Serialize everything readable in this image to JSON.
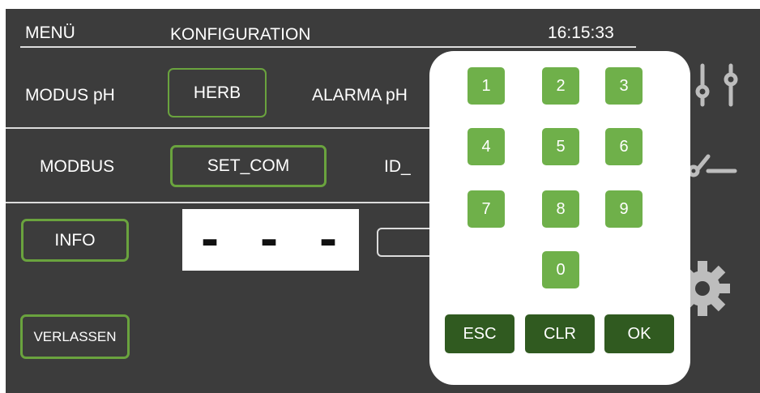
{
  "header": {
    "menu_label": "MENÜ",
    "title": "KONFIGURATION",
    "time": "16:15:33"
  },
  "rows": {
    "modus_ph_label": "MODUS pH",
    "modus_ph_value": "HERB",
    "alarma_ph_label": "ALARMA pH",
    "modbus_label": "MODBUS",
    "set_com_label": "SET_COM",
    "id_label": "ID_",
    "info_label": "INFO",
    "display_value": "- - -",
    "exit_label": "VERLASSEN"
  },
  "keypad": {
    "digits": [
      "1",
      "2",
      "3",
      "4",
      "5",
      "6",
      "7",
      "8",
      "9",
      "0"
    ],
    "esc_label": "ESC",
    "clr_label": "CLR",
    "ok_label": "OK"
  },
  "side_icons": [
    "sliders-icon",
    "switch-icon",
    "gear-icon"
  ],
  "colors": {
    "background": "#3c3c3c",
    "button_border": "#6aa33e",
    "digit_key": "#6fb04a",
    "function_key": "#305a20",
    "keypad_panel": "#ffffff"
  }
}
